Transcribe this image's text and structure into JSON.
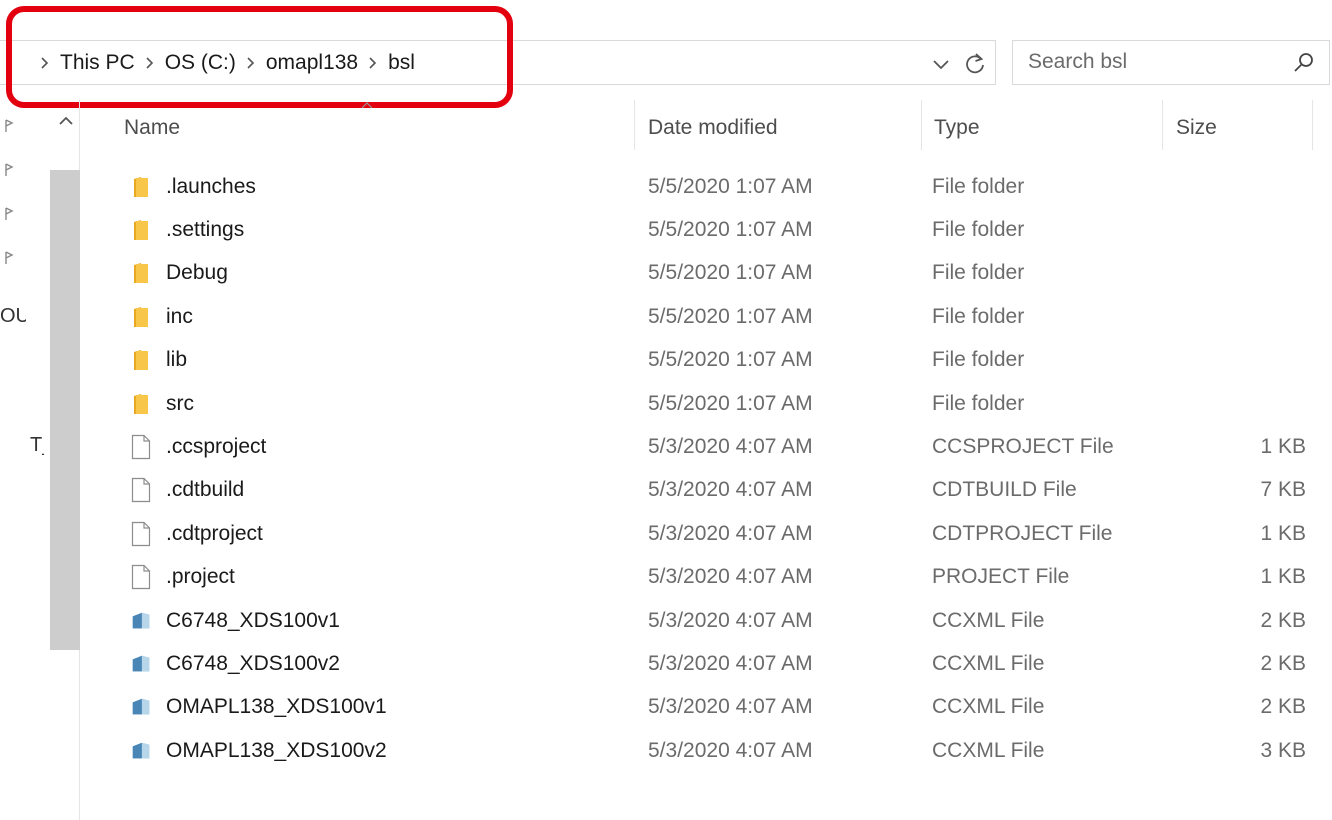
{
  "breadcrumb": {
    "items": [
      "This PC",
      "OS (C:)",
      "omapl138",
      "bsl"
    ]
  },
  "search": {
    "placeholder": "Search bsl"
  },
  "nav": {
    "fragment_a": "OU",
    "fragment_b": "T_"
  },
  "columns": {
    "name": "Name",
    "date": "Date modified",
    "type": "Type",
    "size": "Size"
  },
  "files": [
    {
      "name": ".launches",
      "date": "5/5/2020 1:07 AM",
      "type": "File folder",
      "size": "",
      "icon": "folder-icon"
    },
    {
      "name": ".settings",
      "date": "5/5/2020 1:07 AM",
      "type": "File folder",
      "size": "",
      "icon": "folder-icon"
    },
    {
      "name": "Debug",
      "date": "5/5/2020 1:07 AM",
      "type": "File folder",
      "size": "",
      "icon": "folder-icon"
    },
    {
      "name": "inc",
      "date": "5/5/2020 1:07 AM",
      "type": "File folder",
      "size": "",
      "icon": "folder-icon"
    },
    {
      "name": "lib",
      "date": "5/5/2020 1:07 AM",
      "type": "File folder",
      "size": "",
      "icon": "folder-icon"
    },
    {
      "name": "src",
      "date": "5/5/2020 1:07 AM",
      "type": "File folder",
      "size": "",
      "icon": "folder-icon"
    },
    {
      "name": ".ccsproject",
      "date": "5/3/2020 4:07 AM",
      "type": "CCSPROJECT File",
      "size": "1 KB",
      "icon": "file-icon"
    },
    {
      "name": ".cdtbuild",
      "date": "5/3/2020 4:07 AM",
      "type": "CDTBUILD File",
      "size": "7 KB",
      "icon": "file-icon"
    },
    {
      "name": ".cdtproject",
      "date": "5/3/2020 4:07 AM",
      "type": "CDTPROJECT File",
      "size": "1 KB",
      "icon": "file-icon"
    },
    {
      "name": ".project",
      "date": "5/3/2020 4:07 AM",
      "type": "PROJECT File",
      "size": "1 KB",
      "icon": "file-icon"
    },
    {
      "name": "C6748_XDS100v1",
      "date": "5/3/2020 4:07 AM",
      "type": "CCXML File",
      "size": "2 KB",
      "icon": "ccxml-file-icon"
    },
    {
      "name": "C6748_XDS100v2",
      "date": "5/3/2020 4:07 AM",
      "type": "CCXML File",
      "size": "2 KB",
      "icon": "ccxml-file-icon"
    },
    {
      "name": "OMAPL138_XDS100v1",
      "date": "5/3/2020 4:07 AM",
      "type": "CCXML File",
      "size": "2 KB",
      "icon": "ccxml-file-icon"
    },
    {
      "name": "OMAPL138_XDS100v2",
      "date": "5/3/2020 4:07 AM",
      "type": "CCXML File",
      "size": "3 KB",
      "icon": "ccxml-file-icon"
    }
  ],
  "colors": {
    "highlight": "#e3000f",
    "folder": "#f8c749",
    "secondary_text": "#6b6b6b"
  }
}
